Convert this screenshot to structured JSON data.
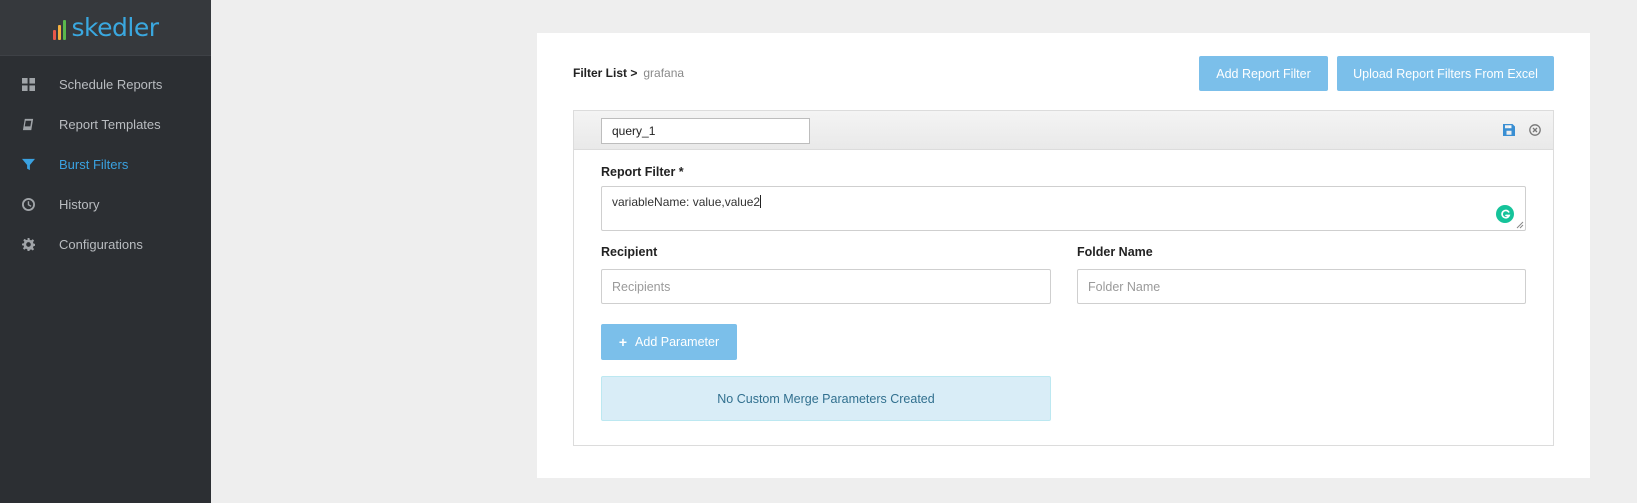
{
  "brand": {
    "name": "skedler",
    "color": "#3aa8e0",
    "bar_colors": [
      "#e8574a",
      "#f5b040",
      "#5ab84c"
    ]
  },
  "sidebar": {
    "items": [
      {
        "label": "Schedule Reports",
        "icon": "dashboard-grid-icon",
        "active": false
      },
      {
        "label": "Report Templates",
        "icon": "book-icon",
        "active": false
      },
      {
        "label": "Burst Filters",
        "icon": "filter-icon",
        "active": true
      },
      {
        "label": "History",
        "icon": "clock-icon",
        "active": false
      },
      {
        "label": "Configurations",
        "icon": "gear-icon",
        "active": false
      }
    ]
  },
  "breadcrumb": {
    "root": "Filter List >",
    "current": "grafana"
  },
  "toolbar": {
    "add_filter_label": "Add Report Filter",
    "upload_label": "Upload Report Filters From Excel"
  },
  "filter": {
    "name_value": "query_1",
    "report_filter_label": "Report Filter *",
    "report_filter_value": "variableName: value,value2",
    "recipient_label": "Recipient",
    "recipient_placeholder": "Recipients",
    "folder_label": "Folder Name",
    "folder_placeholder": "Folder Name",
    "add_parameter_label": "Add Parameter",
    "empty_params_message": "No Custom Merge Parameters Created"
  },
  "colors": {
    "sidebar_bg": "#2c2f33",
    "accent": "#3aa1e0",
    "button_bg": "#7bbfea",
    "info_bg": "#d9edf7",
    "info_text": "#31708f"
  }
}
